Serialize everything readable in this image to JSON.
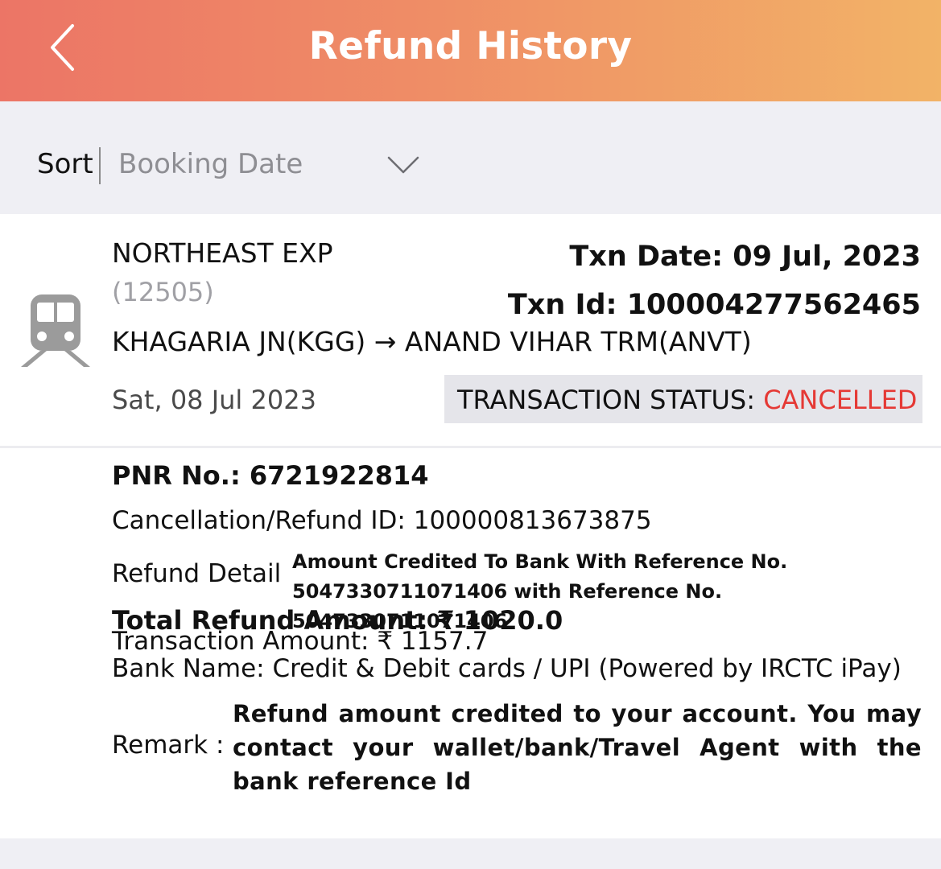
{
  "header": {
    "title": "Refund History",
    "back_icon": "chevron-left-icon"
  },
  "sort": {
    "label": "Sort",
    "selected": "Booking Date",
    "dropdown_icon": "chevron-down-icon"
  },
  "transaction": {
    "train_icon": "train-icon",
    "train_name": "NORTHEAST EXP",
    "train_number": "(12505)",
    "route": "KHAGARIA JN(KGG) → ANAND VIHAR TRM(ANVT)",
    "journey_date": "Sat, 08 Jul 2023",
    "txn_date": "Txn Date:  09 Jul, 2023",
    "txn_id": "Txn Id:  100004277562465",
    "status_label": "TRANSACTION STATUS: ",
    "status_value": "CANCELLED",
    "status_color": "#e53935"
  },
  "details": {
    "pnr": "PNR No.: 6721922814",
    "refund_id": "Cancellation/Refund ID: 100000813673875",
    "refund_detail_label": "Refund Detail",
    "refund_detail_value": "Amount Credited To Bank With Reference No. 5047330711071406 with Reference No. 5047330711071406",
    "total_refund": "Total Refund Amount: ₹ 1020.0",
    "transaction_amount": "Transaction Amount: ₹ 1157.7",
    "bank_name": "Bank Name: Credit & Debit cards / UPI (Powered by IRCTC iPay)",
    "remark_label": "Remark :",
    "remark_value": "Refund amount credited to your account. You may contact your wallet/bank/Travel Agent with the bank reference Id"
  }
}
